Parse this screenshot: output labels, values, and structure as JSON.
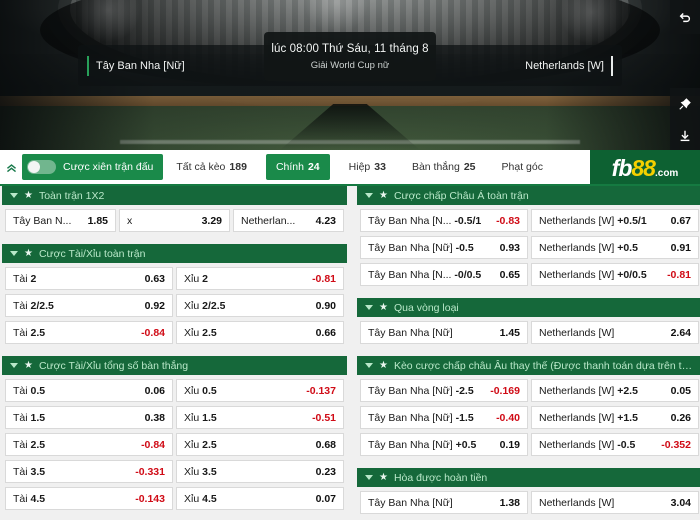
{
  "hero": {
    "home_team": "Tây Ban Nha [Nữ]",
    "away_team": "Netherlands [W]",
    "match_time": "lúc 08:00 Thứ Sáu, 11 tháng 8",
    "league": "Giải World Cup nữ",
    "icons": {
      "back": "undo-arrow-icon",
      "pin": "pin-icon",
      "download": "download-icon"
    }
  },
  "nav": {
    "collapse_icon": "double-chevron-up-icon",
    "parlay_label": "Cược xiên trận đấu",
    "parlay_on": false,
    "tabs": [
      {
        "label": "Tất cả kèo",
        "count": "189",
        "active": false
      },
      {
        "label": "Chính",
        "count": "24",
        "active": true
      },
      {
        "label": "Hiệp",
        "count": "33",
        "active": false
      },
      {
        "label": "Bàn thắng",
        "count": "25",
        "active": false
      },
      {
        "label": "Phạt góc",
        "count": "",
        "active": false
      }
    ],
    "logo": {
      "fb": "fb",
      "eightyeight": "88",
      "com": ".com"
    }
  },
  "left_column": [
    {
      "title": "Toàn trận 1X2",
      "rows": [
        [
          {
            "label": "Tây Ban N...",
            "value": "1.85",
            "negative": false
          },
          {
            "label": "x",
            "value": "3.29",
            "negative": false
          },
          {
            "label": "Netherlan...",
            "value": "4.23",
            "negative": false
          }
        ]
      ]
    },
    {
      "title": "Cược Tài/Xỉu toàn trận",
      "rows": [
        [
          {
            "label": "Tài",
            "line": "2",
            "value": "0.63",
            "negative": false
          },
          {
            "label": "Xỉu",
            "line": "2",
            "value": "-0.81",
            "negative": true
          }
        ],
        [
          {
            "label": "Tài",
            "line": "2/2.5",
            "value": "0.92",
            "negative": false
          },
          {
            "label": "Xỉu",
            "line": "2/2.5",
            "value": "0.90",
            "negative": false
          }
        ],
        [
          {
            "label": "Tài",
            "line": "2.5",
            "value": "-0.84",
            "negative": true
          },
          {
            "label": "Xỉu",
            "line": "2.5",
            "value": "0.66",
            "negative": false
          }
        ]
      ]
    },
    {
      "title": "Cược Tài/Xỉu tổng số bàn thắng",
      "rows": [
        [
          {
            "label": "Tài",
            "line": "0.5",
            "value": "0.06",
            "negative": false
          },
          {
            "label": "Xỉu",
            "line": "0.5",
            "value": "-0.137",
            "negative": true
          }
        ],
        [
          {
            "label": "Tài",
            "line": "1.5",
            "value": "0.38",
            "negative": false
          },
          {
            "label": "Xỉu",
            "line": "1.5",
            "value": "-0.51",
            "negative": true
          }
        ],
        [
          {
            "label": "Tài",
            "line": "2.5",
            "value": "-0.84",
            "negative": true
          },
          {
            "label": "Xỉu",
            "line": "2.5",
            "value": "0.68",
            "negative": false
          }
        ],
        [
          {
            "label": "Tài",
            "line": "3.5",
            "value": "-0.331",
            "negative": true
          },
          {
            "label": "Xỉu",
            "line": "3.5",
            "value": "0.23",
            "negative": false
          }
        ],
        [
          {
            "label": "Tài",
            "line": "4.5",
            "value": "-0.143",
            "negative": true
          },
          {
            "label": "Xỉu",
            "line": "4.5",
            "value": "0.07",
            "negative": false
          }
        ]
      ]
    }
  ],
  "right_column": [
    {
      "title": "Cược chấp Châu Á toàn trận",
      "rows": [
        [
          {
            "label": "Tây Ban Nha [N...",
            "line": "-0.5/1",
            "value": "-0.83",
            "negative": true
          },
          {
            "label": "Netherlands [W]",
            "line": "+0.5/1",
            "value": "0.67",
            "negative": false
          }
        ],
        [
          {
            "label": "Tây Ban Nha [Nữ]",
            "line": "-0.5",
            "value": "0.93",
            "negative": false
          },
          {
            "label": "Netherlands [W]",
            "line": "+0.5",
            "value": "0.91",
            "negative": false
          }
        ],
        [
          {
            "label": "Tây Ban Nha [N...",
            "line": "-0/0.5",
            "value": "0.65",
            "negative": false
          },
          {
            "label": "Netherlands [W]",
            "line": "+0/0.5",
            "value": "-0.81",
            "negative": true
          }
        ]
      ]
    },
    {
      "title": "Qua vòng loại",
      "rows": [
        [
          {
            "label": "Tây Ban Nha [Nữ]",
            "value": "1.45",
            "negative": false
          },
          {
            "label": "Netherlands [W]",
            "value": "2.64",
            "negative": false
          }
        ]
      ]
    },
    {
      "title": "Kèo cược chấp châu Âu thay thế (Được thanh toán dựa trên tỷ ...",
      "rows": [
        [
          {
            "label": "Tây Ban Nha [Nữ]",
            "line": "-2.5",
            "value": "-0.169",
            "negative": true
          },
          {
            "label": "Netherlands [W]",
            "line": "+2.5",
            "value": "0.05",
            "negative": false
          }
        ],
        [
          {
            "label": "Tây Ban Nha [Nữ]",
            "line": "-1.5",
            "value": "-0.40",
            "negative": true
          },
          {
            "label": "Netherlands [W]",
            "line": "+1.5",
            "value": "0.26",
            "negative": false
          }
        ],
        [
          {
            "label": "Tây Ban Nha [Nữ]",
            "line": "+0.5",
            "value": "0.19",
            "negative": false
          },
          {
            "label": "Netherlands [W]",
            "line": "-0.5",
            "value": "-0.352",
            "negative": true
          }
        ]
      ]
    },
    {
      "title": "Hòa được hoàn tiền",
      "rows": [
        [
          {
            "label": "Tây Ban Nha [Nữ]",
            "value": "1.38",
            "negative": false
          },
          {
            "label": "Netherlands [W]",
            "value": "3.04",
            "negative": false
          }
        ]
      ]
    }
  ],
  "colors": {
    "brand_green": "#1a8a4a",
    "header_green": "#15683a",
    "logo_green": "#0d6132",
    "negative_red": "#d00b16",
    "logo_yellow": "#f5d000"
  }
}
